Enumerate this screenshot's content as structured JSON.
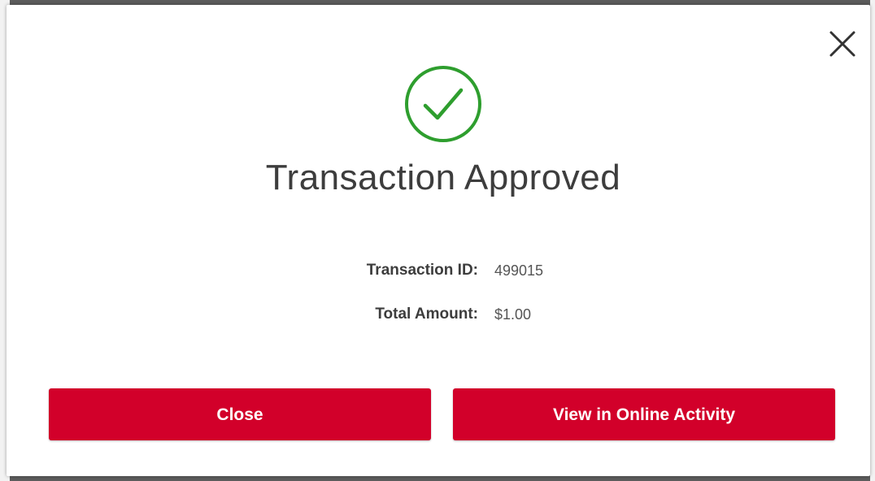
{
  "modal": {
    "title": "Transaction Approved",
    "status_icon": "checkmark-circle-icon",
    "close_icon": "close-icon",
    "accent_color": "#2e9e2e",
    "button_color": "#d2002a",
    "details": [
      {
        "label": "Transaction ID:",
        "value": "499015"
      },
      {
        "label": "Total Amount:",
        "value": "$1.00"
      }
    ],
    "buttons": {
      "close_label": "Close",
      "view_label": "View in Online Activity"
    }
  }
}
